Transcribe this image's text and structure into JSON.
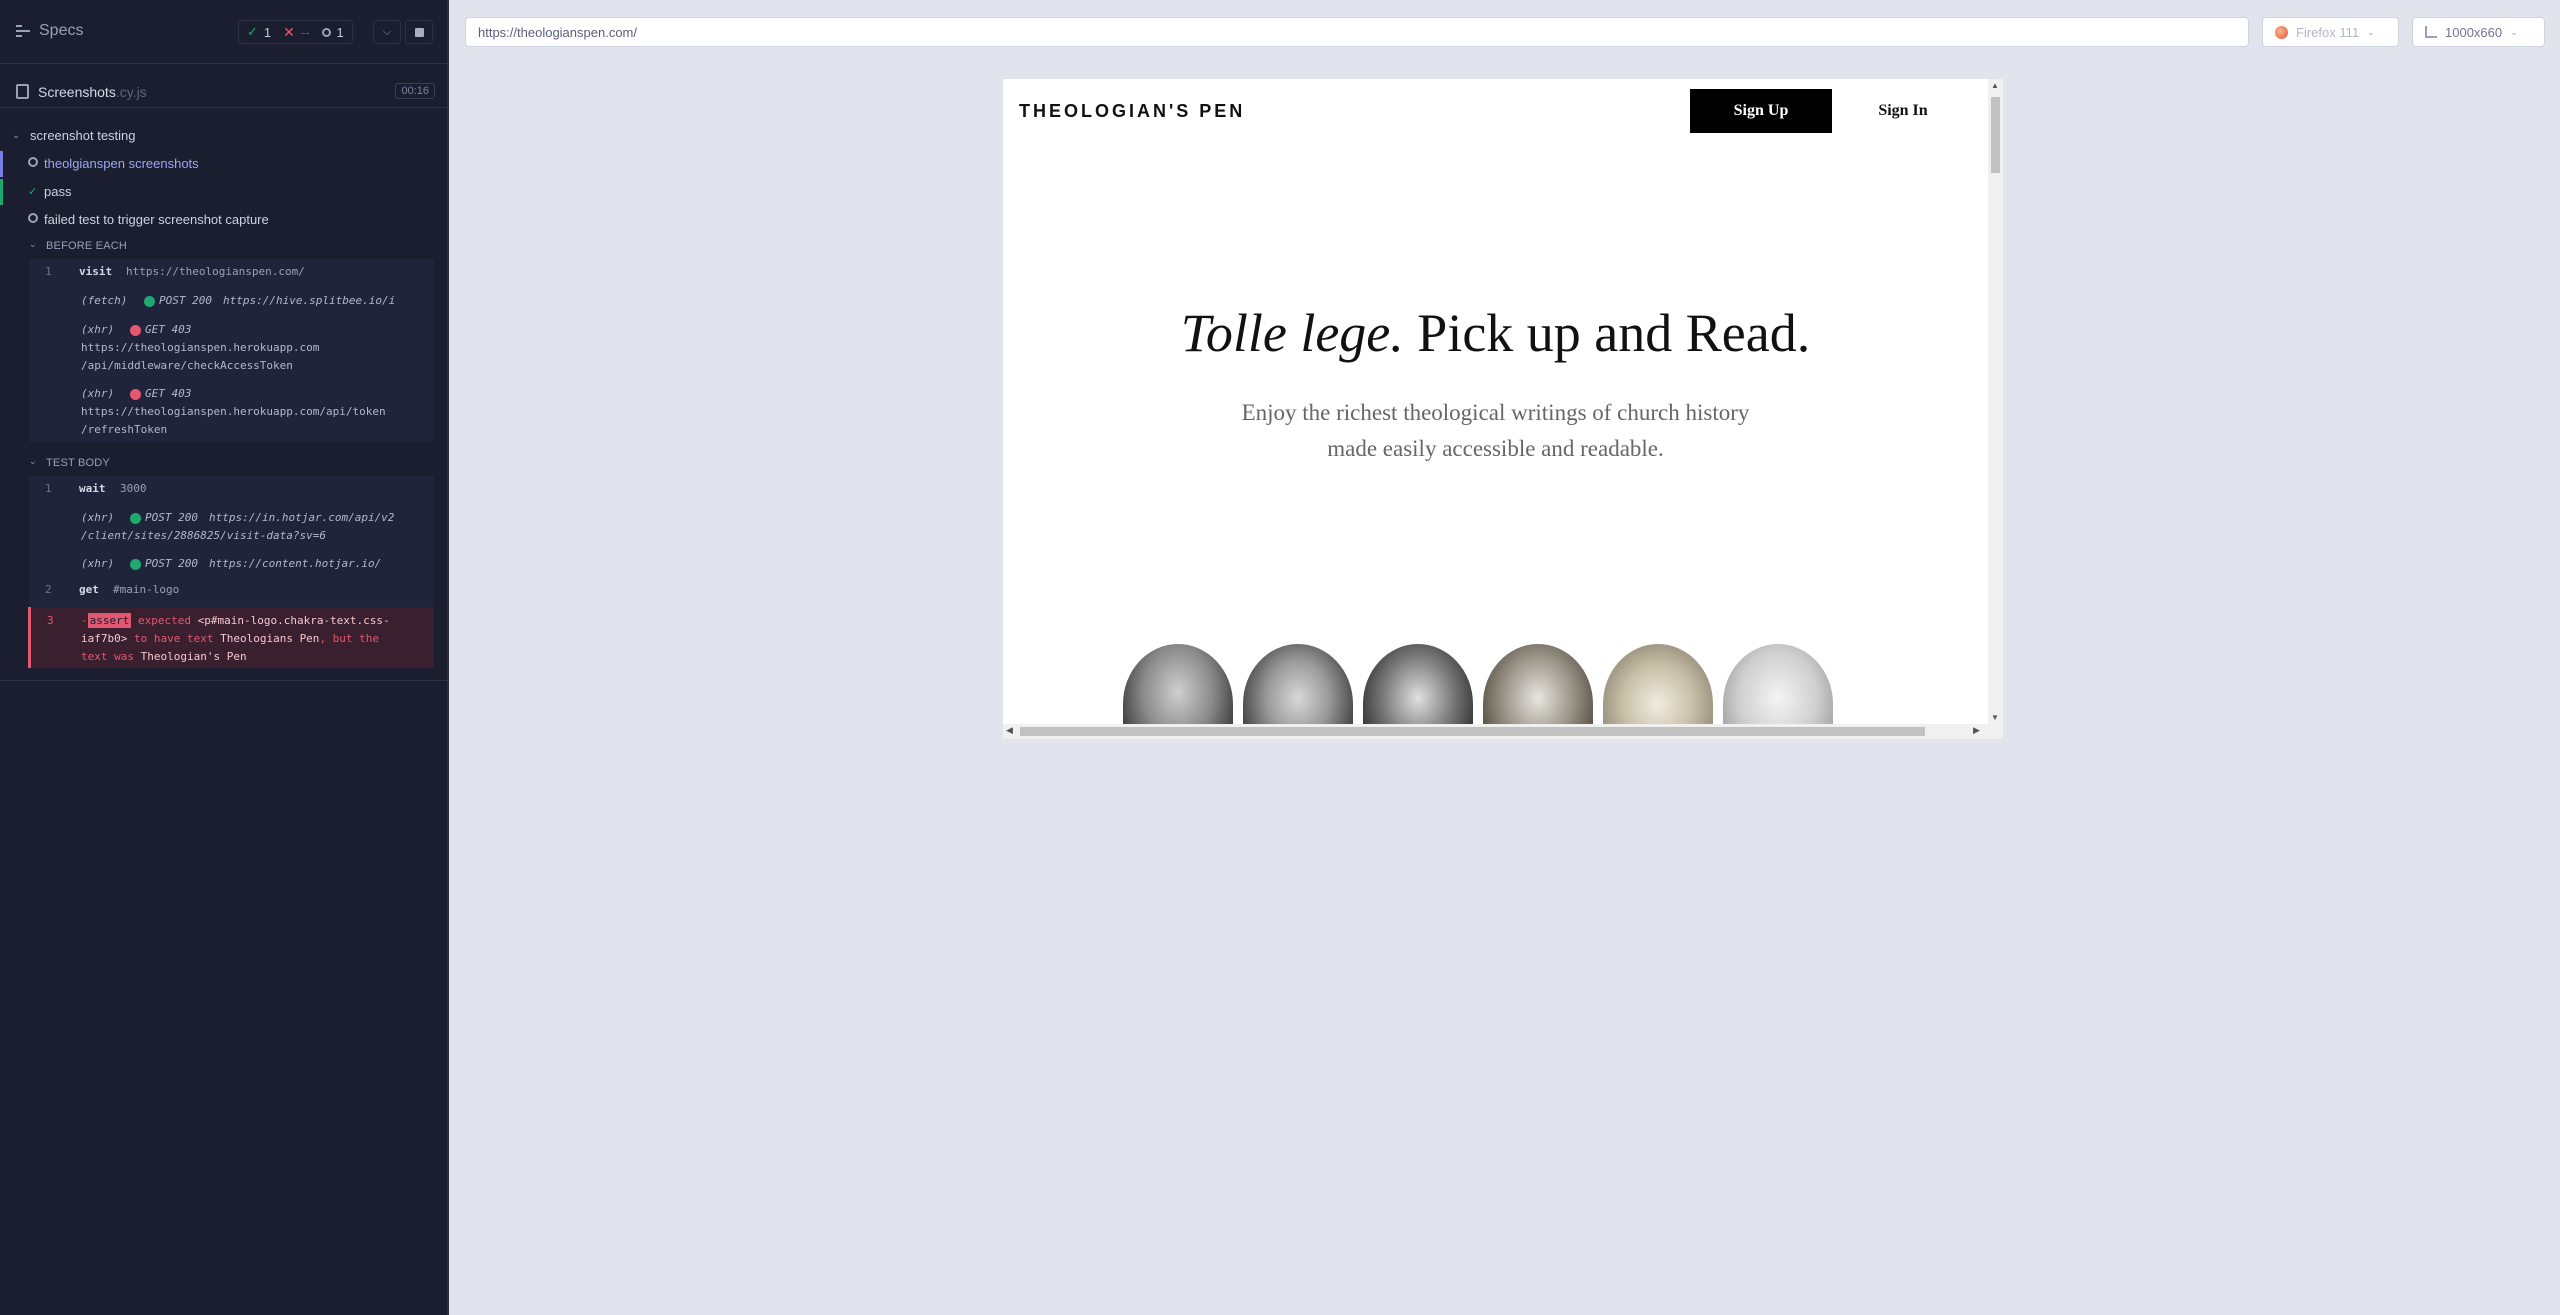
{
  "reporter": {
    "specs_label": "Specs",
    "stats": {
      "passed": "1",
      "failed": "--",
      "pending": "1"
    },
    "file": {
      "name": "Screenshots",
      "ext": ".cy.js",
      "duration": "00:16"
    },
    "suite_label": "screenshot testing",
    "tests": [
      {
        "label": "theolgianspen screenshots",
        "state": "pending"
      },
      {
        "label": "pass",
        "state": "passed"
      },
      {
        "label": "failed test to trigger screenshot capture",
        "state": "pending"
      }
    ],
    "before_each_label": "BEFORE EACH",
    "test_body_label": "TEST BODY",
    "before_each": {
      "visit": {
        "num": "1",
        "name": "visit",
        "msg": "https://theologianspen.com/"
      },
      "fetch": {
        "type": "(fetch)",
        "status": "POST 200",
        "url": "https://hive.splitbee.io/i"
      },
      "xhr1": {
        "type": "(xhr)",
        "status": "GET 403",
        "url_line1": "https://theologianspen.herokuapp.com",
        "url_line2": "/api/middleware/checkAccessToken"
      },
      "xhr2": {
        "type": "(xhr)",
        "status": "GET 403",
        "url_line1": "https://theologianspen.herokuapp.com/api/token",
        "url_line2": "/refreshToken"
      }
    },
    "test_body": {
      "wait": {
        "num": "1",
        "name": "wait",
        "msg": "3000"
      },
      "xhr3": {
        "type": "(xhr)",
        "status": "POST 200",
        "url_line1": "https://in.hotjar.com/api/v2",
        "url_line2": "/client/sites/2886825/visit-data?sv=6"
      },
      "xhr4": {
        "type": "(xhr)",
        "status": "POST 200",
        "url": "https://content.hotjar.io/"
      },
      "get": {
        "num": "2",
        "name": "get",
        "msg": "#main-logo"
      },
      "assert": {
        "num": "3",
        "badge": "assert",
        "t1": "expected",
        "t2": "<p#main-logo.chakra-text.css-",
        "t3": "iaf7b0>",
        "t4": "to have text",
        "t5": "Theologians Pen",
        "t6": ", but the",
        "t7": "text was",
        "t8": "Theologian's Pen"
      }
    }
  },
  "topbar": {
    "url": "https://theologianspen.com/",
    "browser": "Firefox 111",
    "viewport": "1000x660"
  },
  "aut": {
    "logo": "THEOLOGIAN'S PEN",
    "signup": "Sign Up",
    "signin": "Sign In",
    "hero_italic": "Tolle lege.",
    "hero_rest": " Pick up and Read.",
    "sub_line1": "Enjoy the richest theological writings of church history",
    "sub_line2": "made easily accessible and readable."
  },
  "colors": {
    "reporter_bg": "#1b1e2e",
    "pass": "#1fa971",
    "fail": "#e45770",
    "app_bg": "#e1e3ed"
  }
}
